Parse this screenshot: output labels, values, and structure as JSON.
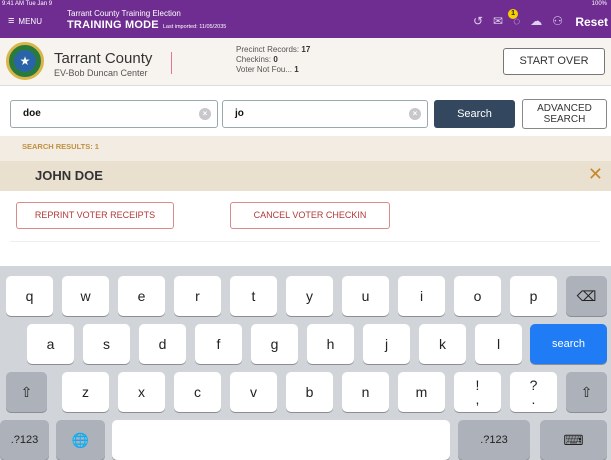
{
  "status": {
    "time": "9:41 AM  Tue Jan 9",
    "battery": "100%"
  },
  "topbar": {
    "menu_label": "MENU",
    "app_title": "Tarrant County Training Election",
    "mode": "TRAINING MODE",
    "last_imported": "Last imported: 11/05/2035",
    "notification_count": "1",
    "reset_label": "Reset",
    "accent_color": "#6f2c91"
  },
  "location": {
    "county": "Tarrant County",
    "center": "EV-Bob Duncan Center",
    "precinct_records_label": "Precinct Records:",
    "precinct_records_value": "17",
    "checkins_label": "Checkins:",
    "checkins_value": "0",
    "voter_not_found_label": "Voter Not Fou...",
    "voter_not_found_value": "1",
    "start_over_label": "START OVER"
  },
  "search": {
    "last_name_value": "doe",
    "first_name_value": "jo",
    "search_label": "Search",
    "advanced_line1": "ADVANCED",
    "advanced_line2": "SEARCH"
  },
  "results": {
    "label": "SEARCH RESULTS: 1",
    "voter_name": "JOHN DOE",
    "reprint_label": "REPRINT VOTER RECEIPTS",
    "cancel_label": "CANCEL VOTER CHECKIN"
  },
  "keyboard": {
    "row1": [
      "q",
      "w",
      "e",
      "r",
      "t",
      "y",
      "u",
      "i",
      "o",
      "p"
    ],
    "row2": [
      "a",
      "s",
      "d",
      "f",
      "g",
      "h",
      "j",
      "k",
      "l"
    ],
    "row3": [
      "z",
      "x",
      "c",
      "v",
      "b",
      "n",
      "m"
    ],
    "punct1_top": "!",
    "punct1_bottom": ",",
    "punct2_top": "?",
    "punct2_bottom": ".",
    "search_key": "search",
    "numbers_key": ".?123",
    "backspace_icon": "⌫",
    "shift_icon": "⇧",
    "globe_icon": "🌐",
    "dismiss_icon": "⌨"
  }
}
